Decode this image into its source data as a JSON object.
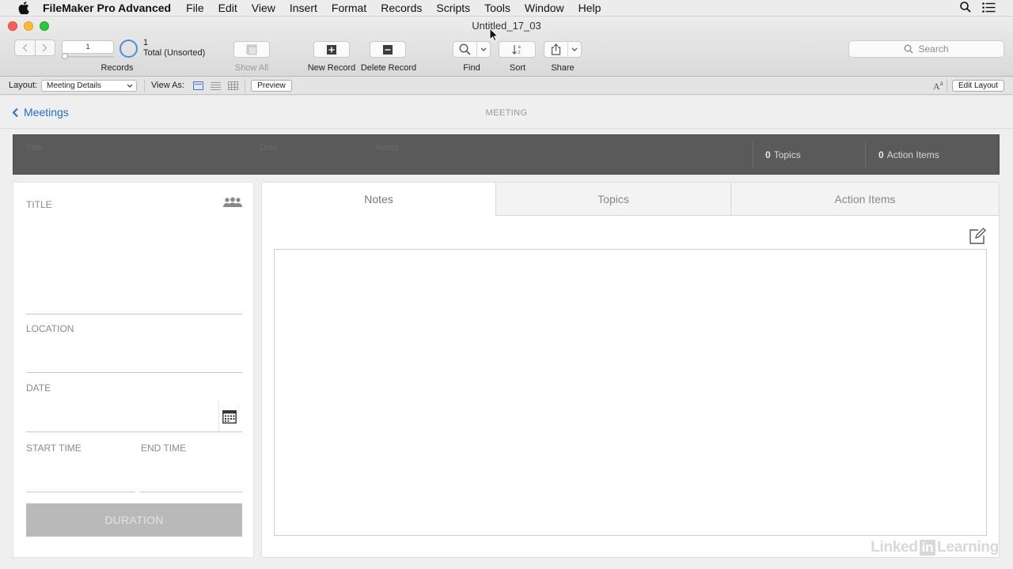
{
  "menubar": {
    "app_name": "FileMaker Pro Advanced",
    "items": [
      "File",
      "Edit",
      "View",
      "Insert",
      "Format",
      "Records",
      "Scripts",
      "Tools",
      "Window",
      "Help"
    ]
  },
  "window": {
    "title": "Untitled_17_03"
  },
  "toolbar": {
    "record_number": "1",
    "found_count": "1",
    "found_status": "Total (Unsorted)",
    "records_label": "Records",
    "show_all_label": "Show All",
    "new_record_label": "New Record",
    "delete_record_label": "Delete Record",
    "find_label": "Find",
    "sort_label": "Sort",
    "share_label": "Share",
    "search_placeholder": "Search"
  },
  "layout_bar": {
    "layout_label": "Layout:",
    "layout_value": "Meeting Details",
    "view_as_label": "View As:",
    "preview_label": "Preview",
    "edit_layout_label": "Edit Layout"
  },
  "header": {
    "back_label": "Meetings",
    "section_title": "MEETING"
  },
  "summary_bar": {
    "placeholder_title": "Title",
    "placeholder_date": "Date",
    "placeholder_notes": "Notes",
    "topics_count": "0",
    "topics_label": "Topics",
    "action_items_count": "0",
    "action_items_label": "Action Items"
  },
  "form": {
    "title_label": "TITLE",
    "location_label": "LOCATION",
    "date_label": "DATE",
    "start_time_label": "START TIME",
    "end_time_label": "END TIME",
    "duration_label": "DURATION"
  },
  "tabs": [
    {
      "label": "Notes",
      "active": true
    },
    {
      "label": "Topics",
      "active": false
    },
    {
      "label": "Action Items",
      "active": false
    }
  ],
  "watermark": {
    "brand_left": "Linked",
    "brand_in": "in",
    "brand_right": "Learning"
  },
  "colors": {
    "accent": "#1e6ed6",
    "summary_bar": "#5a5a5a",
    "duration_button": "#b9b9b9"
  }
}
